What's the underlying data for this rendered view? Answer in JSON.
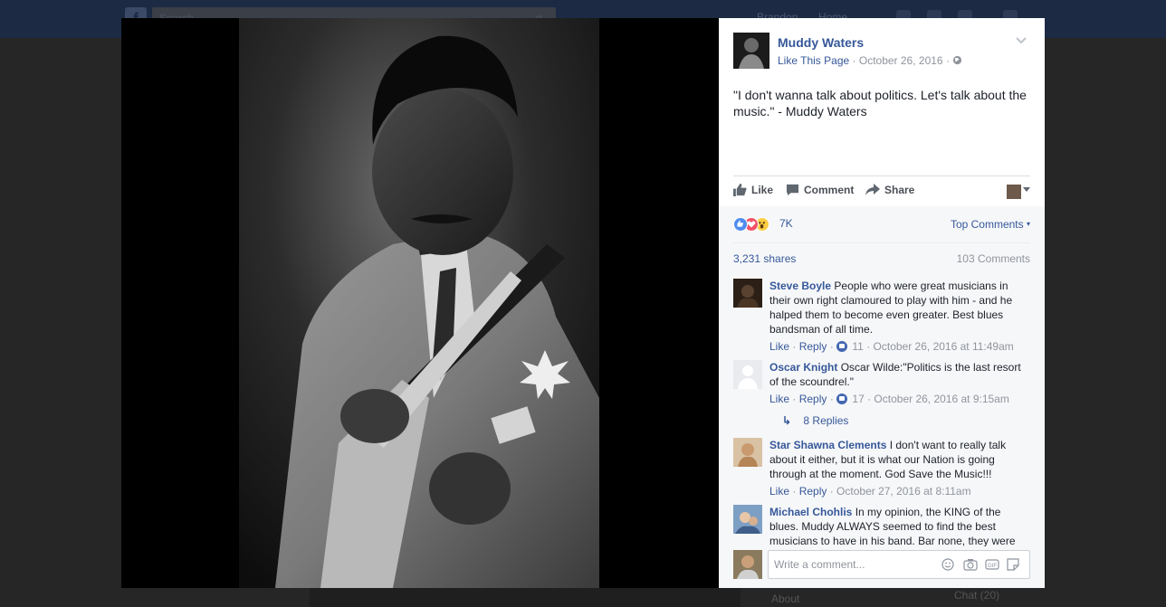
{
  "topbar": {
    "logo": "f",
    "search_placeholder": "Search",
    "user_name": "Brandon",
    "home_label": "Home"
  },
  "post": {
    "page_name": "Muddy Waters",
    "like_page": "Like This Page",
    "date": "October 26, 2016",
    "separator": "·",
    "text": "\"I don't wanna talk about politics. Let's talk about the music.\" - Muddy Waters"
  },
  "actions": {
    "like": "Like",
    "comment": "Comment",
    "share": "Share"
  },
  "reactions": {
    "icons": [
      "like-icon",
      "love-icon",
      "wow-icon"
    ],
    "count": "7K",
    "top_comments": "Top Comments"
  },
  "stats": {
    "shares": "3,231 shares",
    "comments": "103 Comments"
  },
  "comments": [
    {
      "name": "Steve Boyle",
      "text": "People who were great musicians in their own right clamoured to play with him - and he halped them to become even greater. Best blues bandsman of all time.",
      "like": "Like",
      "reply": "Reply",
      "likes": "11",
      "time": "October 26, 2016 at 11:49am"
    },
    {
      "name": "Oscar Knight",
      "text": "Oscar Wilde:\"Politics is the last resort of the scoundrel.\"",
      "like": "Like",
      "reply": "Reply",
      "likes": "17",
      "time": "October 26, 2016 at 9:15am",
      "replies": "8 Replies"
    },
    {
      "name": "Star Shawna Clements",
      "text": "I don't want to really talk about it either, but it is what our Nation is going through at the moment. God Save the Music!!!",
      "like": "Like",
      "reply": "Reply",
      "time": "October 27, 2016 at 8:11am"
    },
    {
      "name": "Michael Chohlis",
      "text": "In my opinion, the KING of the blues. Muddy ALWAYS seemed to find the best musicians to have in his band. Bar none, they were"
    }
  ],
  "composer": {
    "placeholder": "Write a comment...",
    "icons": [
      "emoji-icon",
      "camera-icon",
      "gif-icon",
      "sticker-icon"
    ]
  },
  "background": {
    "about": "About",
    "chat": "Chat (20)"
  }
}
